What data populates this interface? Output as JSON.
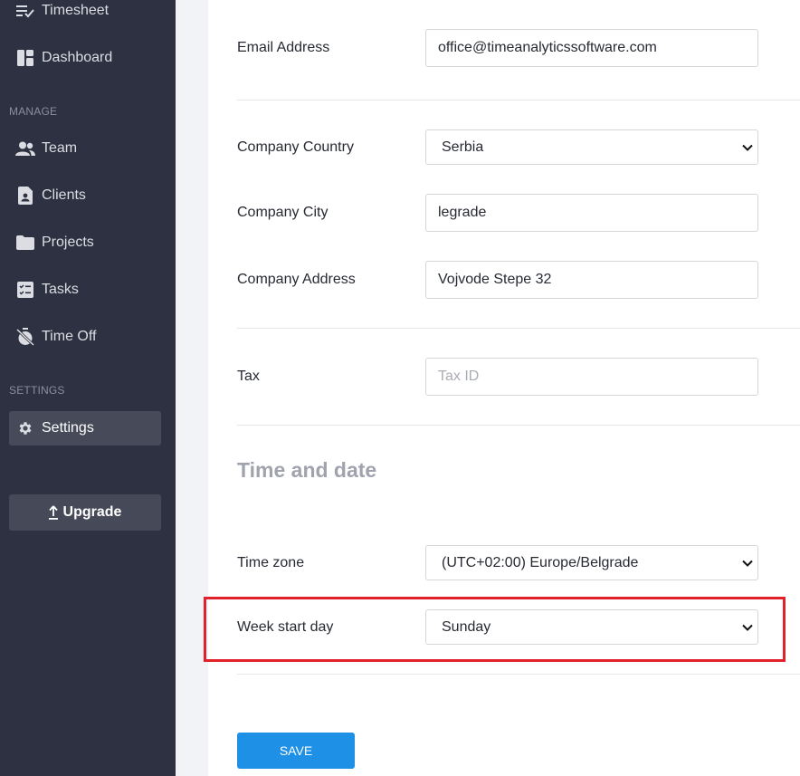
{
  "sidebar": {
    "top_items": [
      {
        "label": "Timesheet",
        "icon": "timesheet-icon"
      },
      {
        "label": "Dashboard",
        "icon": "dashboard-icon"
      }
    ],
    "manage_label": "MANAGE",
    "manage_items": [
      {
        "label": "Team",
        "icon": "team-icon"
      },
      {
        "label": "Clients",
        "icon": "clients-icon"
      },
      {
        "label": "Projects",
        "icon": "folder-icon"
      },
      {
        "label": "Tasks",
        "icon": "tasks-icon"
      },
      {
        "label": "Time Off",
        "icon": "time-off-icon"
      }
    ],
    "settings_label": "SETTINGS",
    "settings_item": {
      "label": "Settings",
      "icon": "gear-icon"
    },
    "upgrade": {
      "label": "Upgrade",
      "icon": "upload-arrow-icon"
    }
  },
  "form": {
    "email": {
      "label": "Email Address",
      "value": "office@timeanalyticssoftware.com"
    },
    "country": {
      "label": "Company Country",
      "value": "Serbia"
    },
    "city": {
      "label": "Company City",
      "value": "legrade"
    },
    "address": {
      "label": "Company Address",
      "value": "Vojvode Stepe 32"
    },
    "tax": {
      "label": "Tax",
      "value": "",
      "placeholder": "Tax ID"
    },
    "time_section_title": "Time and date",
    "timezone": {
      "label": "Time zone",
      "value": "(UTC+02:00) Europe/Belgrade"
    },
    "week_start": {
      "label": "Week start day",
      "value": "Sunday"
    },
    "save_label": "SAVE"
  },
  "colors": {
    "sidebar_bg": "#2e3141",
    "accent": "#1e90e6",
    "highlight": "#e3212b"
  }
}
